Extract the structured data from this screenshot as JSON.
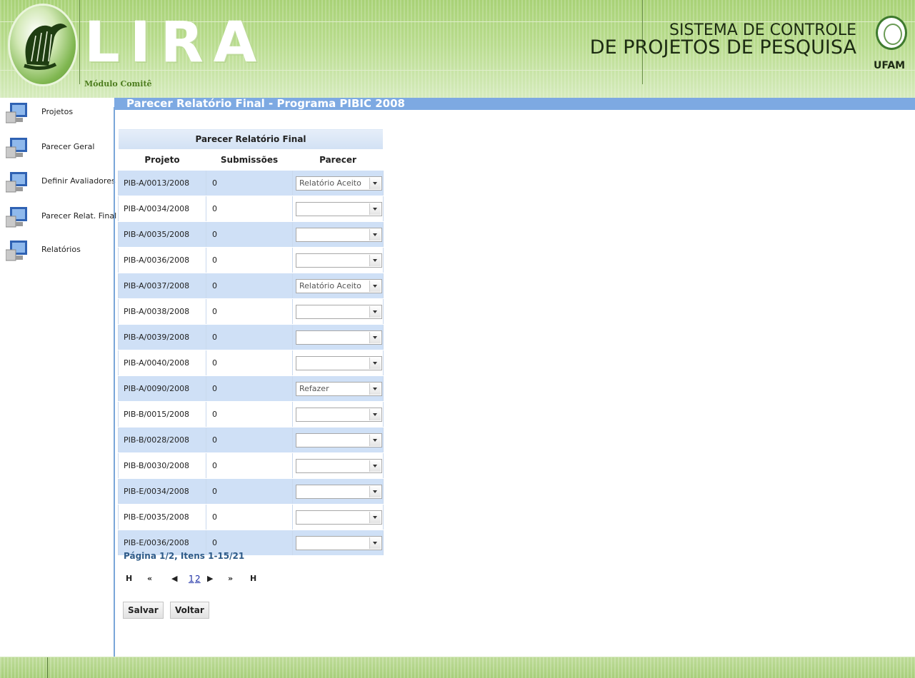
{
  "header": {
    "app_name": "LIRA",
    "module": "Módulo Comitê",
    "system_line1": "SISTEMA DE CONTROLE",
    "system_line2": "DE PROJETOS DE PESQUISA",
    "institution": "UFAM"
  },
  "sidebar": {
    "items": [
      {
        "label": "Projetos",
        "icon": "monitor-icon"
      },
      {
        "label": "Parecer Geral",
        "icon": "monitor-icon"
      },
      {
        "label": "Definir Avaliadores",
        "icon": "monitor-icon"
      },
      {
        "label": "Parecer Relat. Final",
        "icon": "monitor-icon"
      },
      {
        "label": "Relatórios",
        "icon": "monitor-icon"
      }
    ]
  },
  "main": {
    "title": "Parecer Relatório Final - Programa PIBIC 2008",
    "table": {
      "caption": "Parecer Relatório Final",
      "columns": [
        "Projeto",
        "Submissões",
        "Parecer"
      ],
      "rows": [
        {
          "projeto": "PIB-A/0013/2008",
          "submissoes": "0",
          "parecer": "Relatório Aceito"
        },
        {
          "projeto": "PIB-A/0034/2008",
          "submissoes": "0",
          "parecer": ""
        },
        {
          "projeto": "PIB-A/0035/2008",
          "submissoes": "0",
          "parecer": ""
        },
        {
          "projeto": "PIB-A/0036/2008",
          "submissoes": "0",
          "parecer": ""
        },
        {
          "projeto": "PIB-A/0037/2008",
          "submissoes": "0",
          "parecer": "Relatório Aceito"
        },
        {
          "projeto": "PIB-A/0038/2008",
          "submissoes": "0",
          "parecer": ""
        },
        {
          "projeto": "PIB-A/0039/2008",
          "submissoes": "0",
          "parecer": ""
        },
        {
          "projeto": "PIB-A/0040/2008",
          "submissoes": "0",
          "parecer": ""
        },
        {
          "projeto": "PIB-A/0090/2008",
          "submissoes": "0",
          "parecer": "Refazer"
        },
        {
          "projeto": "PIB-B/0015/2008",
          "submissoes": "0",
          "parecer": ""
        },
        {
          "projeto": "PIB-B/0028/2008",
          "submissoes": "0",
          "parecer": ""
        },
        {
          "projeto": "PIB-B/0030/2008",
          "submissoes": "0",
          "parecer": ""
        },
        {
          "projeto": "PIB-E/0034/2008",
          "submissoes": "0",
          "parecer": ""
        },
        {
          "projeto": "PIB-E/0035/2008",
          "submissoes": "0",
          "parecer": ""
        },
        {
          "projeto": "PIB-E/0036/2008",
          "submissoes": "0",
          "parecer": ""
        }
      ]
    },
    "pagination": {
      "info": "Página 1/2, Itens 1-15/21",
      "first": "H",
      "fast_prev": "«",
      "prev": "◀",
      "page1": "1",
      "page2": "2",
      "next": "▶",
      "fast_next": "»",
      "last": "H"
    },
    "buttons": {
      "save": "Salvar",
      "back": "Voltar"
    }
  },
  "colors": {
    "header_green": "#b9dc8e",
    "title_blue": "#7da9e2",
    "row_blue": "#cfe0f6",
    "pagination_text": "#2d5a88"
  }
}
